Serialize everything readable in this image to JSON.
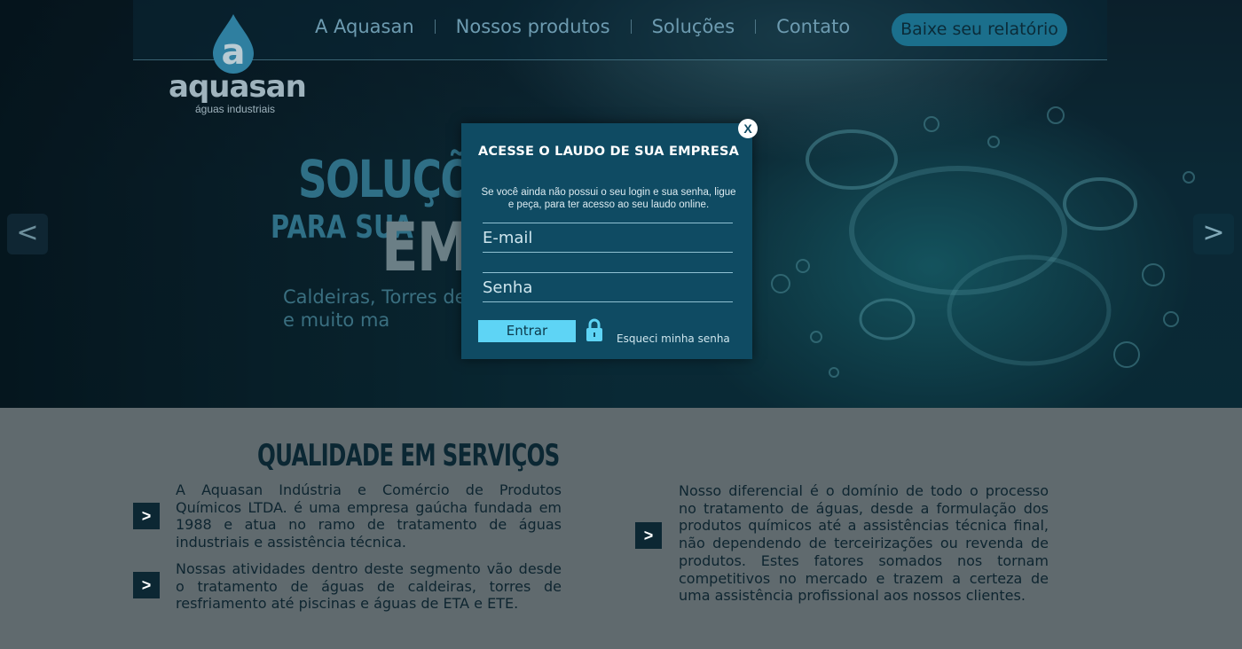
{
  "brand": {
    "logo_letter": "a",
    "name": "aquasan",
    "tagline": "águas industriais"
  },
  "nav": {
    "items": [
      "A Aquasan",
      "Nossos produtos",
      "Soluções",
      "Contato"
    ],
    "cta": "Baixe seu relatório"
  },
  "hero": {
    "headline": "SOLUÇÕES",
    "subline_small": "PARA SUA",
    "subline_big": "EMP",
    "paragraph": "Caldeiras, Torres de piscinas e muito ma",
    "prev_arrow": "<",
    "next_arrow": ">"
  },
  "modal": {
    "close": "X",
    "title": "ACESSE O LAUDO DE SUA EMPRESA",
    "text": "Se você ainda não possui o seu login e sua senha, ligue e peça, para ter acesso ao seu laudo online.",
    "email_placeholder": "E-mail",
    "password_placeholder": "Senha",
    "submit": "Entrar",
    "forgot": "Esqueci minha senha"
  },
  "section": {
    "title": "QUALIDADE EM SERVIÇOS",
    "bullet_glyph": ">",
    "items": [
      "A Aquasan Indústria e Comércio de Produtos Químicos LTDA. é uma empresa gaúcha fundada em 1988 e atua no ramo de tratamento de águas industriais e assistência técnica.",
      "Nossas atividades dentro deste segmento vão desde o tratamento de águas de caldeiras, torres de resfriamento até piscinas e águas de ETA e ETE.",
      "Nosso diferencial é o domínio de todo o processo no tratamento de águas, desde a formulação dos produtos químicos até a assistências técnica final, não dependendo de terceirizações ou revenda de produtos. Estes fatores somados nos tornam competitivos no mercado e trazem a certeza de uma assistência profissional aos nossos clientes."
    ]
  }
}
